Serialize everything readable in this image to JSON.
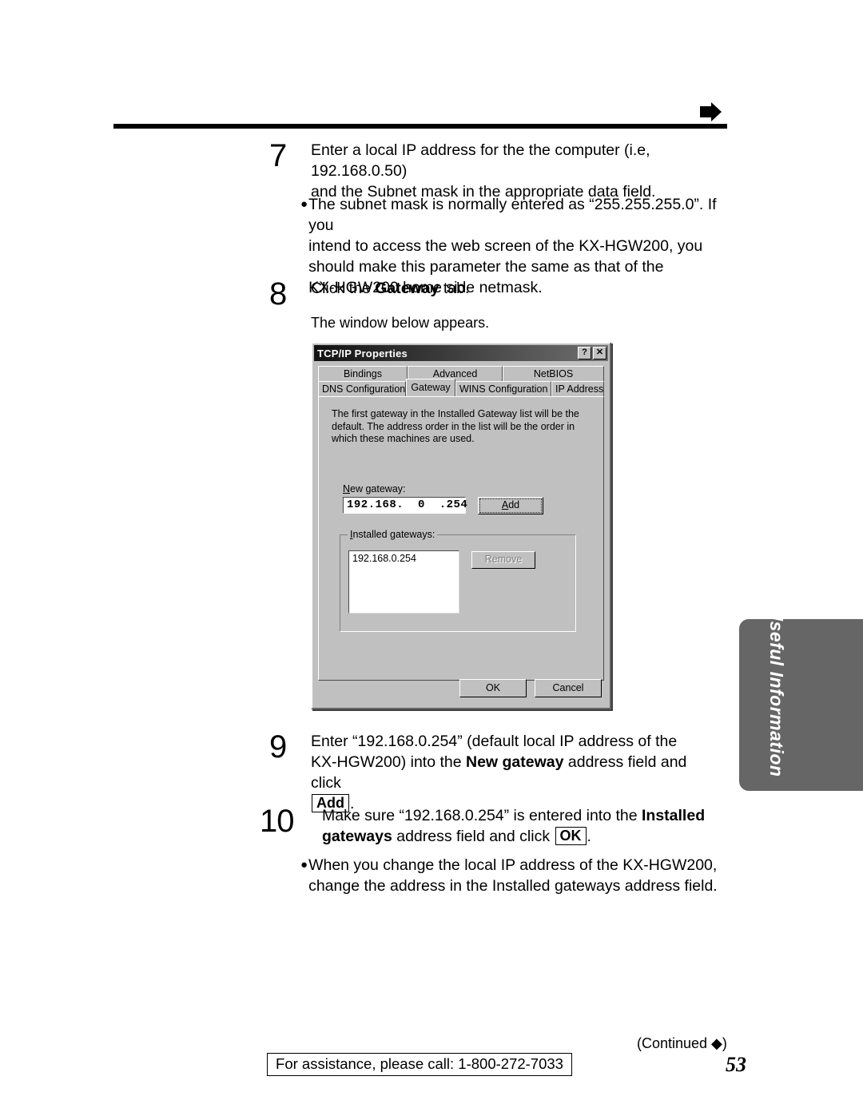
{
  "header": {
    "arrow_icon": "right-arrow-icon"
  },
  "steps": [
    {
      "number": "7",
      "line1": "Enter a local IP address for the the computer (i.e, 192.168.0.50)",
      "line2": "and the Subnet mask in the appropriate data field."
    },
    {
      "number": "8",
      "line1": "Click the ",
      "bold": "Gateway",
      "line2": " tab.",
      "note": "The window below appears."
    }
  ],
  "bullets": {
    "subnet_mask": {
      "dot": "●",
      "line1": "The subnet mask is normally entered as “255.255.255.0”. If you",
      "line2": "intend to access the web screen of the KX-HGW200, you",
      "line3": "should make this parameter the same as that of the",
      "line4": "KX-HGW200 home side netmask."
    },
    "change_address": {
      "dot": "●",
      "line1": "When you change the local IP address of the KX-HGW200,",
      "line2": "change the address in the Installed gateways address field."
    }
  },
  "step9": {
    "number": "9",
    "part1": "Enter “192.168.0.254” (default local IP address of the",
    "part2": "KX-HGW200) into the ",
    "bold1": "New gateway",
    "part3": " address field and click",
    "keycap": "Add",
    "period": "."
  },
  "step10": {
    "number": "10",
    "part1": "Make sure “192.168.0.254” is entered into the ",
    "bold1": "Installed",
    "bold2": "gateways",
    "part2": " address field and click ",
    "keycap": "OK",
    "period": "."
  },
  "dialog": {
    "title": "TCP/IP Properties",
    "help_button": "?",
    "close_button": "✕",
    "tabs_row1": [
      {
        "label": "Bindings",
        "selected": false
      },
      {
        "label": "Advanced",
        "selected": false
      },
      {
        "label": "NetBIOS",
        "selected": false
      }
    ],
    "tabs_row2": [
      {
        "label": "DNS Configuration",
        "selected": false
      },
      {
        "label": "Gateway",
        "selected": true
      },
      {
        "label": "WINS Configuration",
        "selected": false
      },
      {
        "label": "IP Address",
        "selected": false
      }
    ],
    "description": "The first gateway in the Installed Gateway list will be the default. The address order in the list will be the order in which these machines are used.",
    "new_gateway": {
      "label_accel": "N",
      "label_rest": "ew gateway:",
      "value": "192.168.  0  .254",
      "add_accel": "A",
      "add_rest": "dd"
    },
    "installed_gateways": {
      "label_accel": "I",
      "label_rest": "nstalled gateways:",
      "items": [
        "192.168.0.254"
      ],
      "remove_accel": "R",
      "remove_rest": "emove",
      "remove_disabled": true
    },
    "ok_label": "OK",
    "cancel_label": "Cancel"
  },
  "side_tab": {
    "label": "Useful Information",
    "color": "#666666"
  },
  "footer": {
    "continued": "(Continued ◆)",
    "page_number": "53",
    "assistance": "For assistance, please call: 1-800-272-7033"
  }
}
